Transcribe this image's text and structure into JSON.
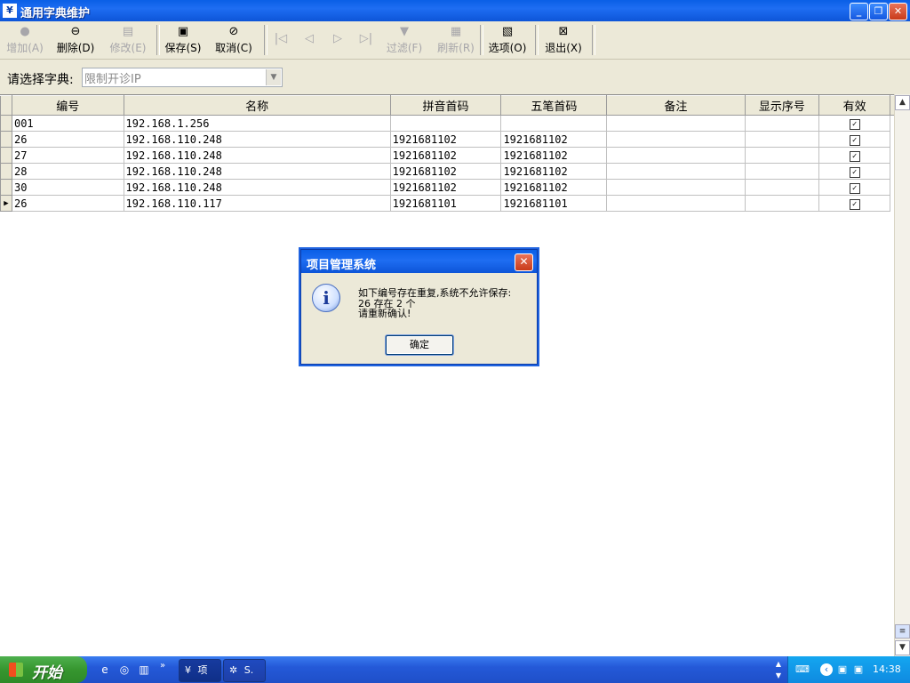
{
  "window": {
    "title": "通用字典维护",
    "icon_char": "¥"
  },
  "toolbar": {
    "buttons": [
      {
        "label": "增加(A)",
        "icon": "add-icon",
        "glyph": "●",
        "enabled": false
      },
      {
        "label": "删除(D)",
        "icon": "delete-icon",
        "glyph": "⊖",
        "enabled": true
      },
      {
        "label": "修改(E)",
        "icon": "edit-icon",
        "glyph": "▤",
        "enabled": false
      },
      {
        "label": "保存(S)",
        "icon": "save-icon",
        "glyph": "▣",
        "enabled": true
      },
      {
        "label": "取消(C)",
        "icon": "cancel-icon",
        "glyph": "⊘",
        "enabled": true
      },
      {
        "label": "",
        "icon": "first-record-icon",
        "glyph": "|◁",
        "enabled": false
      },
      {
        "label": "",
        "icon": "previous-record-icon",
        "glyph": "◁",
        "enabled": false
      },
      {
        "label": "",
        "icon": "next-record-icon",
        "glyph": "▷",
        "enabled": false
      },
      {
        "label": "",
        "icon": "last-record-icon",
        "glyph": "▷|",
        "enabled": false
      },
      {
        "label": "过滤(F)",
        "icon": "filter-icon",
        "glyph": "▼",
        "enabled": false
      },
      {
        "label": "刷新(R)",
        "icon": "refresh-icon",
        "glyph": "▦",
        "enabled": false
      },
      {
        "label": "选项(O)",
        "icon": "options-icon",
        "glyph": "▧",
        "enabled": true
      },
      {
        "label": "退出(X)",
        "icon": "exit-icon",
        "glyph": "⊠",
        "enabled": true
      }
    ]
  },
  "dict_selector": {
    "label": "请选择字典:",
    "value": "限制开诊IP"
  },
  "grid": {
    "columns": [
      "编号",
      "名称",
      "拼音首码",
      "五笔首码",
      "备注",
      "显示序号",
      "有效"
    ],
    "rows": [
      [
        "001",
        "192.168.1.256",
        "",
        "",
        "",
        "",
        true
      ],
      [
        "26",
        "192.168.110.248",
        "1921681102",
        "1921681102",
        "",
        "",
        true
      ],
      [
        "27",
        "192.168.110.248",
        "1921681102",
        "1921681102",
        "",
        "",
        true
      ],
      [
        "28",
        "192.168.110.248",
        "1921681102",
        "1921681102",
        "",
        "",
        true
      ],
      [
        "30",
        "192.168.110.248",
        "1921681102",
        "1921681102",
        "",
        "",
        true
      ],
      [
        "26",
        "192.168.110.117",
        "1921681101",
        "1921681101",
        "",
        "",
        true
      ]
    ],
    "current_row": 5
  },
  "dialog": {
    "title": "项目管理系统",
    "lines": [
      "如下编号存在重复,系统不允许保存:",
      "26 存在 2 个",
      "请重新确认!"
    ],
    "ok_label": "确定"
  },
  "taskbar": {
    "start_label": "开始",
    "tasks": [
      {
        "label": "项",
        "icon": "app-icon"
      },
      {
        "label": "S.",
        "icon": "gear-icon"
      }
    ],
    "clock": "14:38"
  }
}
